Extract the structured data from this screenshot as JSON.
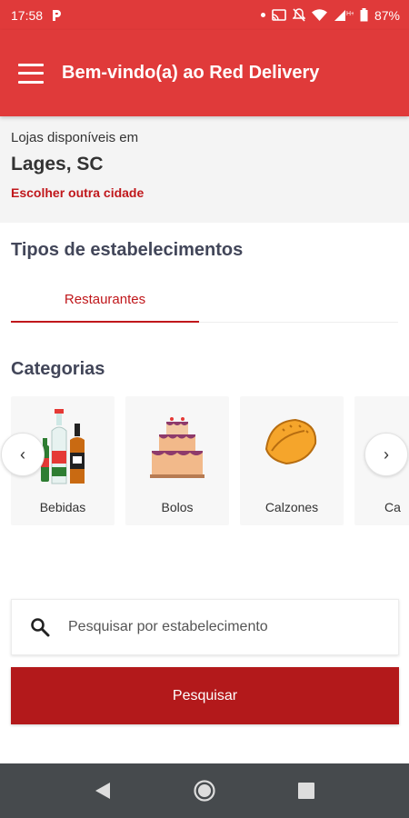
{
  "status_bar": {
    "time": "17:58",
    "battery": "87%",
    "icons": [
      "parking-icon",
      "dot-icon",
      "cast-icon",
      "notifications-off-icon",
      "wifi-icon",
      "signal-icon",
      "battery-icon"
    ]
  },
  "app_bar": {
    "title": "Bem-vindo(a) ao Red Delivery",
    "color": "#e03a3a"
  },
  "location": {
    "label": "Lojas disponíveis em",
    "city": "Lages, SC",
    "change_link": "Escolher outra cidade"
  },
  "establishment_types": {
    "title": "Tipos de estabelecimentos",
    "tabs": [
      {
        "label": "Restaurantes",
        "active": true
      }
    ]
  },
  "categories": {
    "title": "Categorias",
    "items": [
      {
        "label": "Bebidas",
        "icon": "bottles-icon"
      },
      {
        "label": "Bolos",
        "icon": "cake-icon"
      },
      {
        "label": "Calzones",
        "icon": "calzone-icon"
      },
      {
        "label": "Ca",
        "icon": "partial-item-icon"
      }
    ],
    "prev": "‹",
    "next": "›"
  },
  "search": {
    "placeholder": "Pesquisar por estabelecimento",
    "value": "",
    "button": "Pesquisar"
  },
  "colors": {
    "accent": "#e03a3a",
    "link": "#c0171b",
    "button": "#b3191b",
    "nav_bar": "#464a4d"
  }
}
